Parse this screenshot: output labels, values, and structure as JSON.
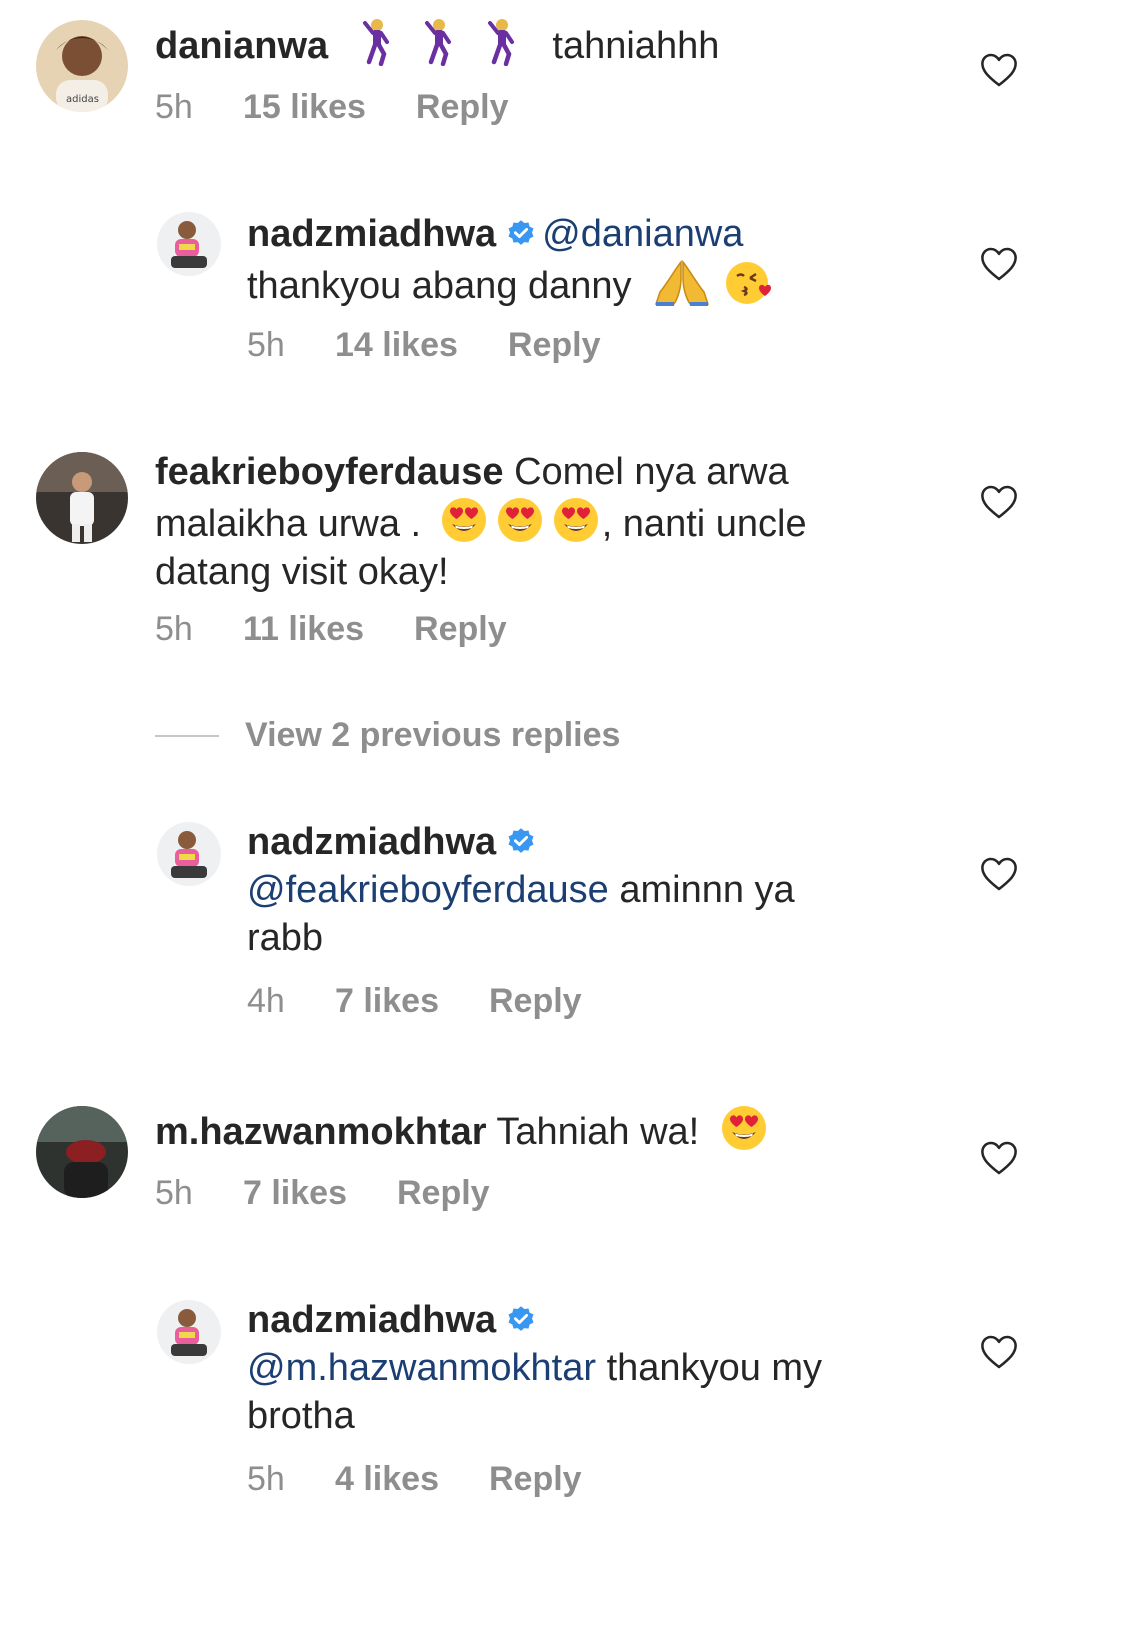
{
  "comments": [
    {
      "username": "danianwa",
      "text": "tahniahhh",
      "time": "5h",
      "likes": "15 likes",
      "reply": "Reply"
    },
    {
      "username": "nadzmiadhwa",
      "mention": "@danianwa",
      "text": "thankyou abang danny",
      "time": "5h",
      "likes": "14 likes",
      "reply": "Reply"
    },
    {
      "username": "feakrieboyferdause",
      "text1": "Comel nya arwa",
      "text2": "malaikha urwa .",
      "text3": ", nanti uncle",
      "text4": "datang visit okay!",
      "time": "5h",
      "likes": "11 likes",
      "reply": "Reply"
    },
    {
      "username": "nadzmiadhwa",
      "mention": "@feakrieboyferdause",
      "text1": "aminnn ya",
      "text2": "rabb",
      "time": "4h",
      "likes": "7 likes",
      "reply": "Reply"
    },
    {
      "username": "m.hazwanmokhtar",
      "text": "Tahniah wa!",
      "time": "5h",
      "likes": "7 likes",
      "reply": "Reply"
    },
    {
      "username": "nadzmiadhwa",
      "mention": "@m.hazwanmokhtar",
      "text1": "thankyou my",
      "text2": "brotha",
      "time": "5h",
      "likes": "4 likes",
      "reply": "Reply"
    }
  ],
  "view_replies": "View 2 previous replies",
  "icons": {
    "heart": "heart-outline-icon",
    "verified": "verified-badge-icon",
    "emoji_dance": "man-dancing-emoji",
    "emoji_pray": "folded-hands-emoji",
    "emoji_kiss": "kissing-heart-emoji",
    "emoji_heart_eyes": "heart-eyes-emoji"
  },
  "colors": {
    "text": "#262626",
    "meta": "#8e8e8e",
    "mention": "#1c3f73",
    "verified": "#3897f0"
  }
}
